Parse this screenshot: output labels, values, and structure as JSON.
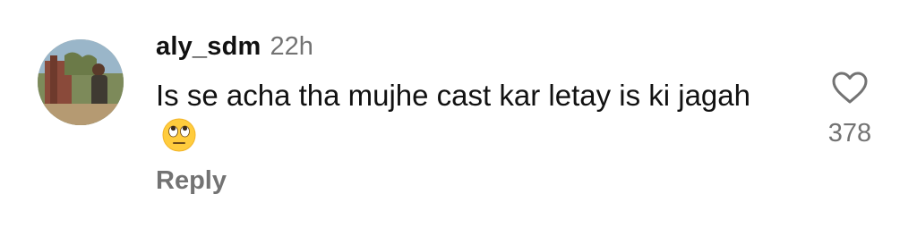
{
  "comment": {
    "username": "aly_sdm",
    "time": "22h",
    "text": "Is se acha tha mujhe cast kar letay is ki jagah",
    "emoji": "face-with-rolling-eyes",
    "reply_label": "Reply",
    "like_count": "378"
  },
  "icons": {
    "avatar": "user-avatar-photo",
    "like": "heart-outline-icon"
  },
  "colors": {
    "primary_text": "#111111",
    "secondary_text": "#737373",
    "background": "#ffffff"
  }
}
